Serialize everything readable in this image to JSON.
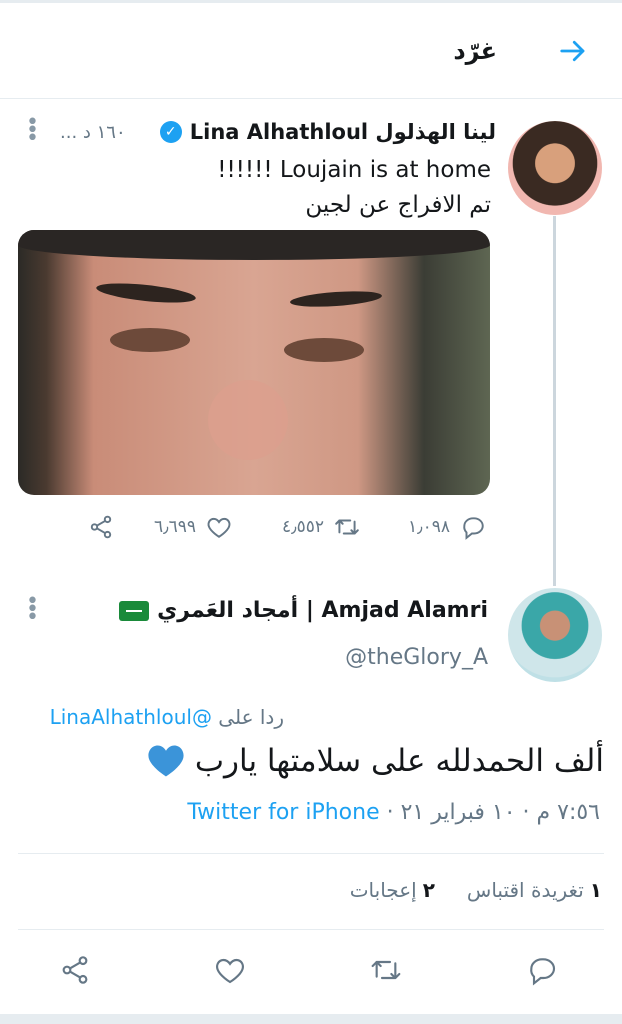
{
  "header": {
    "title": "غرّد"
  },
  "tweet1": {
    "name": "لينا الهذلول Lina Alhathloul",
    "time": "... ١٦٠ د",
    "text_line1": "!!!!!! Loujain is at home",
    "text_line2": "تم الافراج عن لجين",
    "replies": "١٫٠٩٨",
    "retweets": "٤٫٥٥٢",
    "likes": "٦٫٦٩٩"
  },
  "tweet2": {
    "name": "Amjad Alamri | أمجاد العَمري",
    "handle": "@theGlory_A",
    "reply_prefix": "ردا على",
    "reply_mention": "@LinaAlhathloul",
    "body": "ألف الحمدلله على سلامتها يارب",
    "datetime": "٧:٥٦ م · ١٠ فبراير ٢١ · ",
    "source": "Twitter for iPhone",
    "stats": {
      "quote_count": "١",
      "quote_label": "تغريدة اقتباس",
      "likes_count": "٢",
      "likes_label": "إعجابات"
    }
  },
  "icons": {
    "back": "arrow-right-icon",
    "verified": "verified-badge-icon",
    "reply": "reply-icon",
    "retweet": "retweet-icon",
    "like": "heart-icon",
    "share": "share-icon",
    "menu": "more-vertical-icon",
    "flag": "saudi-flag-emoji",
    "blue_heart": "blue-heart-emoji"
  },
  "colors": {
    "accent": "#1da1f2",
    "muted": "#657786",
    "text": "#14171a",
    "border": "#e6ecf0"
  }
}
